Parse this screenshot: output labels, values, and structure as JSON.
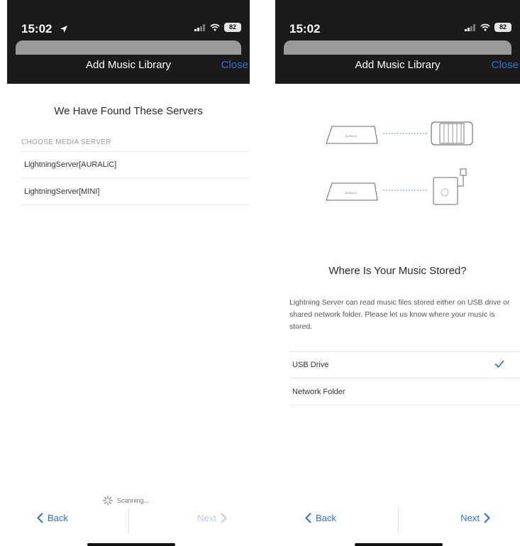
{
  "left_screen": {
    "status": {
      "time": "15:02",
      "battery": "82"
    },
    "nav": {
      "title": "Add Music Library",
      "close_label": "Close"
    },
    "heading": "We Have Found These Servers",
    "section_caption": "CHOOSE MEDIA SERVER",
    "servers": [
      {
        "label": "LightningServer[AURALiC]"
      },
      {
        "label": "LightningServer[MINI]"
      }
    ],
    "scanning_label": "Scanning...",
    "footer": {
      "back_label": "Back",
      "next_label": "Next"
    }
  },
  "right_screen": {
    "status": {
      "time": "15:02",
      "battery": "82"
    },
    "nav": {
      "title": "Add Music Library",
      "close_label": "Close"
    },
    "illustration": {
      "device_label_1": "AURALiC",
      "device_label_2": "AURALiC"
    },
    "heading": "Where Is Your Music Stored?",
    "description": "Lightning Server can read music files stored either on USB drive or shared network folder. Please let us know where your music is stored.",
    "options": [
      {
        "label": "USB Drive",
        "selected": true
      },
      {
        "label": "Network Folder",
        "selected": false
      }
    ],
    "footer": {
      "back_label": "Back",
      "next_label": "Next"
    }
  },
  "colors": {
    "accent": "#2f6fd6",
    "nav_background": "#1b1b1b",
    "next_disabled": "#b9cdea"
  }
}
